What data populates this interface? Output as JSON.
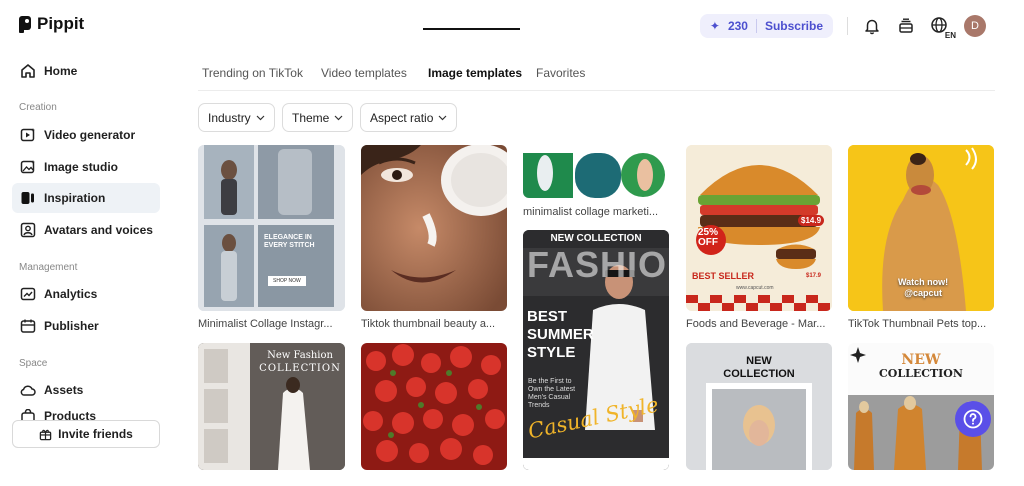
{
  "app": {
    "name": "Pippit"
  },
  "sidebar": {
    "home": "Home",
    "sections": {
      "creation": "Creation",
      "management": "Management",
      "space": "Space"
    },
    "items": {
      "video_generator": "Video generator",
      "image_studio": "Image studio",
      "inspiration": "Inspiration",
      "avatars_and_voices": "Avatars and voices",
      "analytics": "Analytics",
      "publisher": "Publisher",
      "assets": "Assets",
      "products": "Products"
    },
    "invite_label": "Invite friends"
  },
  "header": {
    "credits": "230",
    "subscribe_label": "Subscribe",
    "language": "EN",
    "avatar_initial": "D"
  },
  "tabs": {
    "trending": "Trending on TikTok",
    "video_templates": "Video templates",
    "image_templates": "Image templates",
    "favorites": "Favorites",
    "active": "Image templates"
  },
  "filters": {
    "industry": "Industry",
    "theme": "Theme",
    "aspect_ratio": "Aspect ratio"
  },
  "templates": {
    "c1r1": {
      "caption": "Minimalist Collage Instagr...",
      "text_1": "ELEGANCE IN",
      "text_2": "EVERY STITCH",
      "button": "SHOP NOW"
    },
    "c2r1": {
      "caption": "Tiktok thumbnail beauty a..."
    },
    "c3r1": {
      "caption": "minimalist collage marketi..."
    },
    "c3r2": {
      "kicker": "NEW COLLECTION",
      "headline": "FASHION",
      "line_1": "BEST",
      "line_2": "SUMMER",
      "line_3": "STYLE",
      "small": "Be the First to Own the Latest Men's Casual Trends",
      "script": "Casual Style"
    },
    "c4r1": {
      "caption": "Foods and Beverage - Mar...",
      "badge_pct": "25%",
      "badge_off": "OFF",
      "best_seller": "BEST SELLER",
      "price_1": "$14.9",
      "price_2": "$17.9",
      "url": "www.capcut.com"
    },
    "c5r1": {
      "caption": "TikTok Thumbnail Pets top...",
      "watch_1": "Watch now!",
      "watch_2": "@capcut"
    },
    "c1r2": {
      "title_1": "New Fashion",
      "title_2": "COLLECTION"
    },
    "c4r2": {
      "title_1": "NEW",
      "title_2": "COLLECTION"
    },
    "c5r2": {
      "title_1": "NEW",
      "title_2": "COLLECTION"
    }
  },
  "colors": {
    "accent": "#5a4fe8",
    "subscribe": "#4c4fcf",
    "active_nav_bg": "#eef2f6"
  }
}
